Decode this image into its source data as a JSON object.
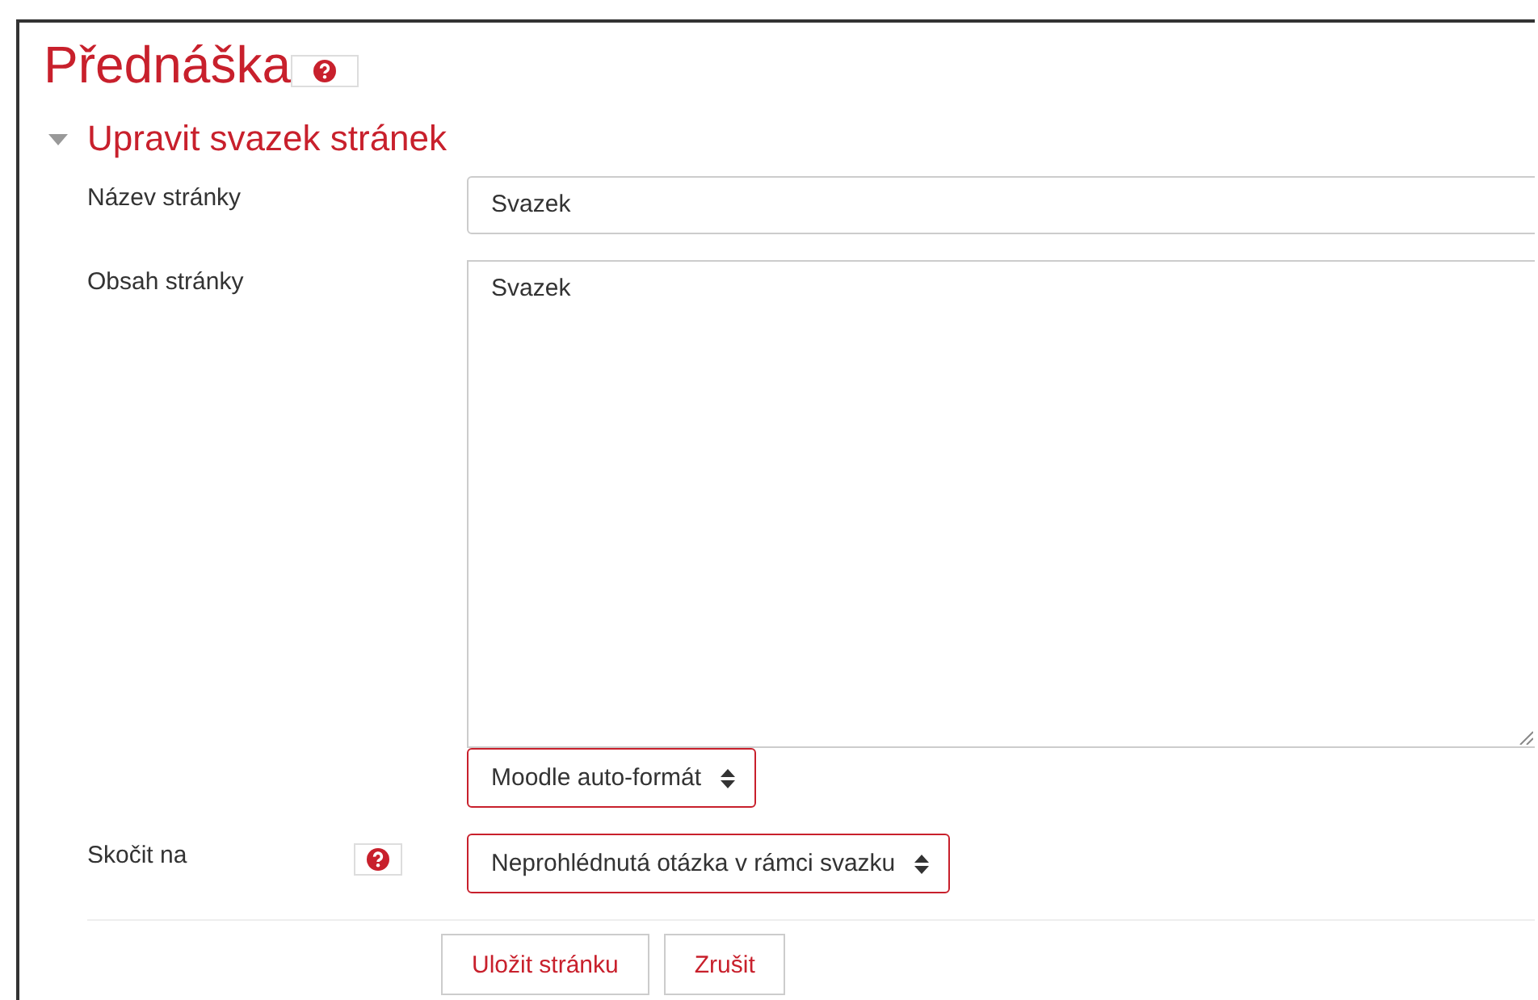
{
  "page": {
    "title": "Přednáška",
    "help": true
  },
  "section": {
    "heading": "Upravit svazek stránek",
    "expanded": true
  },
  "fields": [
    {
      "kind": "text",
      "label": "Název stránky",
      "value": "Svazek",
      "help": false
    },
    {
      "kind": "textarea",
      "label": "Obsah stránky",
      "value": "Svazek",
      "format": "Moodle auto-formát",
      "help": false
    },
    {
      "kind": "select",
      "label": "Skočit na",
      "value": "Neprohlédnutá otázka v rámci svazku",
      "help": true
    }
  ],
  "buttons": [
    "Uložit stránku",
    "Zrušit"
  ]
}
